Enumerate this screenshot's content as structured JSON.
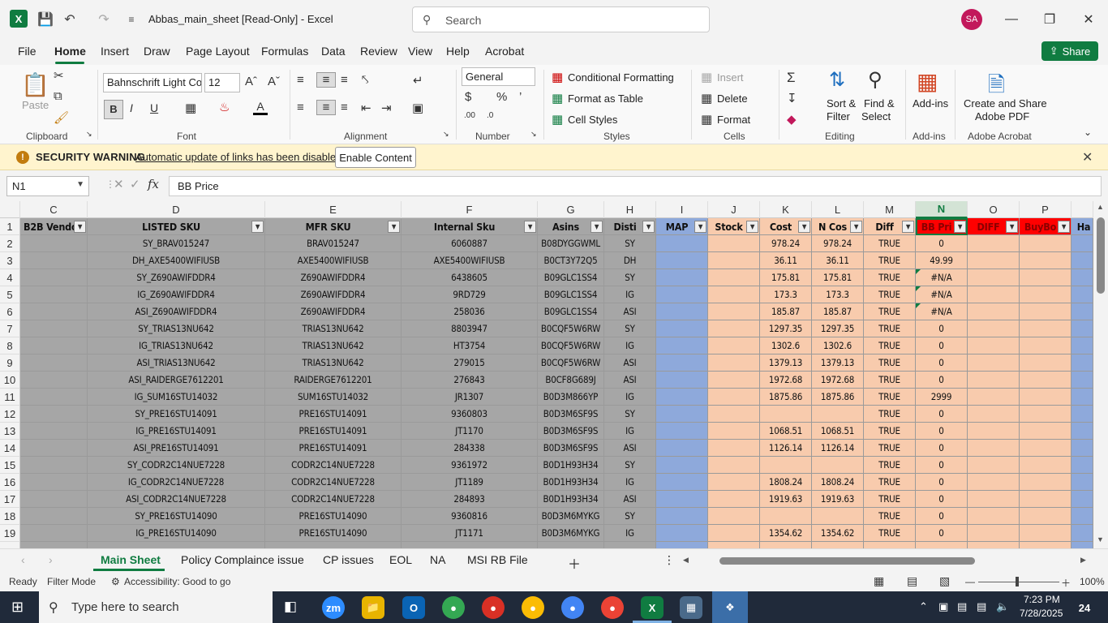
{
  "window": {
    "title": "Abbas_main_sheet  [Read-Only]  -  Excel",
    "search_placeholder": "Search",
    "avatar_initials": "SA"
  },
  "menu": {
    "items": [
      "File",
      "Home",
      "Insert",
      "Draw",
      "Page Layout",
      "Formulas",
      "Data",
      "Review",
      "View",
      "Help",
      "Acrobat"
    ],
    "active": "Home",
    "share_label": "Share"
  },
  "ribbon": {
    "clipboard": {
      "label": "Clipboard",
      "paste": "Paste"
    },
    "font": {
      "label": "Font",
      "name": "Bahnschrift Light Co",
      "size": "12"
    },
    "alignment": {
      "label": "Alignment"
    },
    "number": {
      "label": "Number",
      "format": "General"
    },
    "styles": {
      "label": "Styles",
      "conditional": "Conditional Formatting",
      "format_table": "Format as Table",
      "cell_styles": "Cell Styles"
    },
    "cells": {
      "label": "Cells",
      "insert": "Insert",
      "delete": "Delete",
      "format": "Format"
    },
    "editing": {
      "label": "Editing",
      "sort_filter": "Sort &",
      "sort_filter2": "Filter",
      "find_select": "Find &",
      "find_select2": "Select"
    },
    "addins": {
      "label": "Add-ins",
      "btn": "Add-ins"
    },
    "acrobat": {
      "label": "Adobe Acrobat",
      "btn1": "Create and Share",
      "btn2": "Adobe PDF"
    }
  },
  "security": {
    "title": "SECURITY WARNING",
    "message": "Automatic update of links has been disabled",
    "button": "Enable Content"
  },
  "formula_bar": {
    "name_box": "N1",
    "formula": "BB Price"
  },
  "columns": [
    "C",
    "D",
    "E",
    "F",
    "G",
    "H",
    "I",
    "J",
    "K",
    "L",
    "M",
    "N",
    "O",
    "P",
    ""
  ],
  "selected_column": "N",
  "headers": [
    "B2B Vendo",
    "LISTED SKU",
    "MFR SKU",
    "Internal Sku",
    "Asins",
    "Disti",
    "MAP",
    "Stock",
    "Cost",
    "N Cos",
    "Diff",
    "BB Pri",
    "DIFF",
    "BuyBo",
    "Ha"
  ],
  "rows": [
    [
      "2",
      "",
      "SY_BRAV015247",
      "BRAV015247",
      "6060887",
      "B08DYGGWML",
      "SY",
      "",
      "",
      "978.24",
      "978.24",
      "TRUE",
      "0",
      "",
      ""
    ],
    [
      "3",
      "",
      "DH_AXE5400WIFIUSB",
      "AXE5400WIFIUSB",
      "AXE5400WIFIUSB",
      "B0CT3Y72Q5",
      "DH",
      "",
      "",
      "36.11",
      "36.11",
      "TRUE",
      "49.99",
      "",
      ""
    ],
    [
      "4",
      "",
      "SY_Z690AWIFDDR4",
      "Z690AWIFDDR4",
      "6438605",
      "B09GLC1SS4",
      "SY",
      "",
      "",
      "175.81",
      "175.81",
      "TRUE",
      "#N/A",
      "",
      ""
    ],
    [
      "5",
      "",
      "IG_Z690AWIFDDR4",
      "Z690AWIFDDR4",
      "9RD729",
      "B09GLC1SS4",
      "IG",
      "",
      "",
      "173.3",
      "173.3",
      "TRUE",
      "#N/A",
      "",
      ""
    ],
    [
      "6",
      "",
      "ASI_Z690AWIFDDR4",
      "Z690AWIFDDR4",
      "258036",
      "B09GLC1SS4",
      "ASI",
      "",
      "",
      "185.87",
      "185.87",
      "TRUE",
      "#N/A",
      "",
      ""
    ],
    [
      "7",
      "",
      "SY_TRIAS13NU642",
      "TRIAS13NU642",
      "8803947",
      "B0CQF5W6RW",
      "SY",
      "",
      "",
      "1297.35",
      "1297.35",
      "TRUE",
      "0",
      "",
      ""
    ],
    [
      "8",
      "",
      "IG_TRIAS13NU642",
      "TRIAS13NU642",
      "HT3754",
      "B0CQF5W6RW",
      "IG",
      "",
      "",
      "1302.6",
      "1302.6",
      "TRUE",
      "0",
      "",
      ""
    ],
    [
      "9",
      "",
      "ASI_TRIAS13NU642",
      "TRIAS13NU642",
      "279015",
      "B0CQF5W6RW",
      "ASI",
      "",
      "",
      "1379.13",
      "1379.13",
      "TRUE",
      "0",
      "",
      ""
    ],
    [
      "10",
      "",
      "ASI_RAIDERGE7612201",
      "RAIDERGE7612201",
      "276843",
      "B0CF8G689J",
      "ASI",
      "",
      "",
      "1972.68",
      "1972.68",
      "TRUE",
      "0",
      "",
      ""
    ],
    [
      "11",
      "",
      "IG_SUM16STU14032",
      "SUM16STU14032",
      "JR1307",
      "B0D3M866YP",
      "IG",
      "",
      "",
      "1875.86",
      "1875.86",
      "TRUE",
      "2999",
      "",
      ""
    ],
    [
      "12",
      "",
      "SY_PRE16STU14091",
      "PRE16STU14091",
      "9360803",
      "B0D3M6SF9S",
      "SY",
      "",
      "",
      "",
      "",
      "TRUE",
      "0",
      "",
      ""
    ],
    [
      "13",
      "",
      "IG_PRE16STU14091",
      "PRE16STU14091",
      "JT1170",
      "B0D3M6SF9S",
      "IG",
      "",
      "",
      "1068.51",
      "1068.51",
      "TRUE",
      "0",
      "",
      ""
    ],
    [
      "14",
      "",
      "ASI_PRE16STU14091",
      "PRE16STU14091",
      "284338",
      "B0D3M6SF9S",
      "ASI",
      "",
      "",
      "1126.14",
      "1126.14",
      "TRUE",
      "0",
      "",
      ""
    ],
    [
      "15",
      "",
      "SY_CODR2C14NUE7228",
      "CODR2C14NUE7228",
      "9361972",
      "B0D1H93H34",
      "SY",
      "",
      "",
      "",
      "",
      "TRUE",
      "0",
      "",
      ""
    ],
    [
      "16",
      "",
      "IG_CODR2C14NUE7228",
      "CODR2C14NUE7228",
      "JT1189",
      "B0D1H93H34",
      "IG",
      "",
      "",
      "1808.24",
      "1808.24",
      "TRUE",
      "0",
      "",
      ""
    ],
    [
      "17",
      "",
      "ASI_CODR2C14NUE7228",
      "CODR2C14NUE7228",
      "284893",
      "B0D1H93H34",
      "ASI",
      "",
      "",
      "1919.63",
      "1919.63",
      "TRUE",
      "0",
      "",
      ""
    ],
    [
      "18",
      "",
      "SY_PRE16STU14090",
      "PRE16STU14090",
      "9360816",
      "B0D3M6MYKG",
      "SY",
      "",
      "",
      "",
      "",
      "TRUE",
      "0",
      "",
      ""
    ],
    [
      "19",
      "",
      "IG_PRE16STU14090",
      "PRE16STU14090",
      "JT1171",
      "B0D3M6MYKG",
      "IG",
      "",
      "",
      "1354.62",
      "1354.62",
      "TRUE",
      "0",
      "",
      ""
    ]
  ],
  "sheet_tabs": [
    "Main Sheet",
    "Policy Complaince issue",
    "CP issues",
    "EOL",
    "NA",
    "MSI RB File"
  ],
  "active_sheet": "Main Sheet",
  "status": {
    "ready": "Ready",
    "mode": "Filter Mode",
    "accessibility": "Accessibility: Good to go",
    "zoom": "100%"
  },
  "taskbar": {
    "search_placeholder": "Type here to search",
    "time": "7:23 PM",
    "date": "7/28/2025",
    "notif_count": "24"
  },
  "colors": {
    "excel_green": "#107c41",
    "gray_fill": "#a6a6a6",
    "blue_fill": "#8ea9db",
    "peach_fill": "#f8cbad",
    "red_header": "#ff0000"
  }
}
